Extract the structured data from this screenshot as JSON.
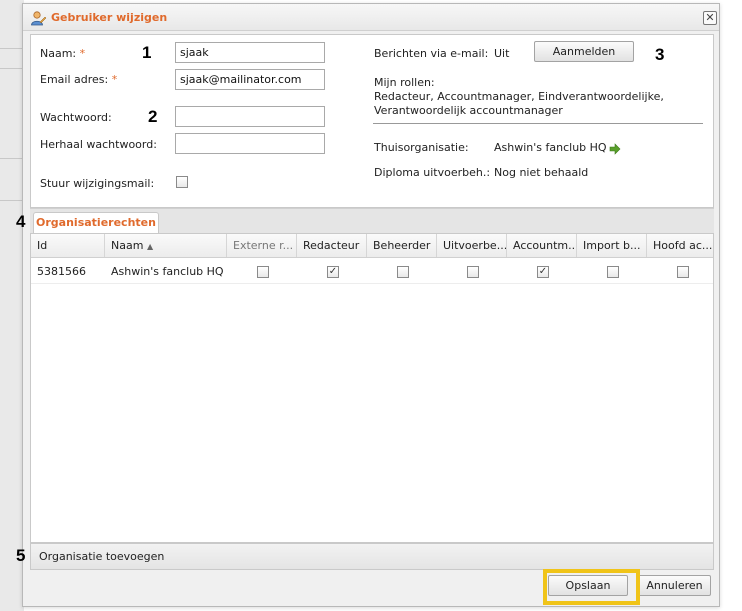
{
  "dialog": {
    "title": "Gebruiker wijzigen",
    "icons": {
      "title": "user-edit-icon",
      "close": "close-icon"
    }
  },
  "form": {
    "name_label": "Naam:",
    "name_value": "sjaak",
    "email_label": "Email adres:",
    "email_value": "sjaak@mailinator.com",
    "password_label": "Wachtwoord:",
    "repeat_password_label": "Herhaal wachtwoord:",
    "send_mail_label": "Stuur wijzigingsmail:",
    "required_marker": "*"
  },
  "info": {
    "email_messages_label": "Berichten via e-mail:",
    "email_messages_value": "Uit",
    "subscribe_button": "Aanmelden",
    "roles_label": "Mijn rollen:",
    "roles_line1": "Redacteur, Accountmanager, Eindverantwoordelijke,",
    "roles_line2": "Verantwoordelijk accountmanager",
    "home_org_label": "Thuisorganisatie:",
    "home_org_value": "Ashwin's fanclub HQ",
    "diploma_label": "Diploma uitvoerbeh.:",
    "diploma_value": "Nog niet behaald"
  },
  "annotations": [
    "1",
    "2",
    "3",
    "4",
    "5"
  ],
  "tabs": [
    {
      "label": "Organisatierechten",
      "active": true
    }
  ],
  "grid": {
    "columns": [
      "Id",
      "Naam",
      "Externe r...",
      "Redacteur",
      "Beheerder",
      "Uitvoerbe...",
      "Accountm...",
      "Import b...",
      "Hoofd ac..."
    ],
    "sort_indicator": "▲",
    "rows": [
      {
        "id": "5381566",
        "naam": "Ashwin's fanclub HQ",
        "externe": false,
        "redacteur": true,
        "beheerder": false,
        "uitvoerbe": false,
        "accountm": true,
        "import": false,
        "hoofd": false
      }
    ]
  },
  "footer": {
    "add_org": "Organisatie toevoegen",
    "save_button": "Opslaan",
    "cancel_button": "Annuleren"
  },
  "colors": {
    "accent": "#e06a2c",
    "highlight": "#f0c419",
    "go_arrow": "#5aa02c"
  }
}
